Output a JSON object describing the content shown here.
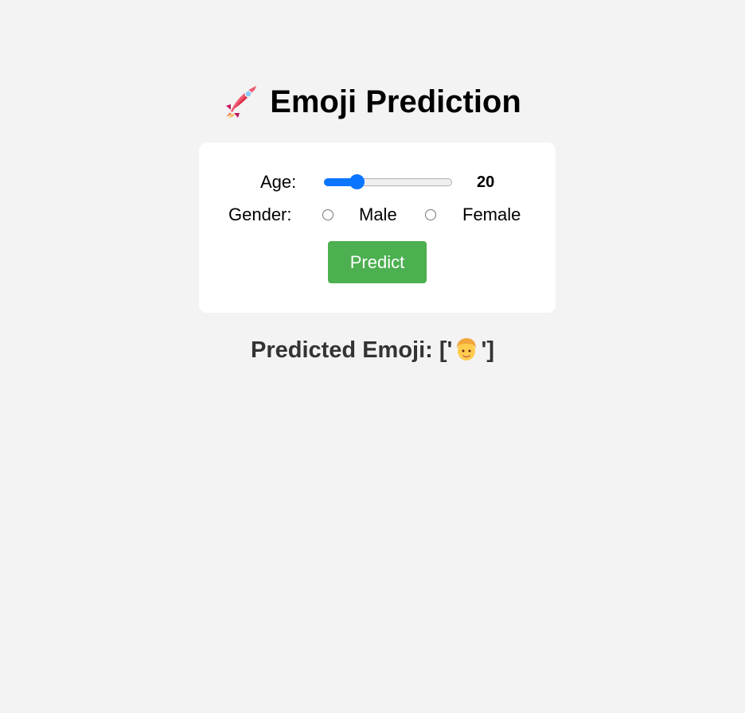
{
  "header": {
    "icon": "rocket-icon",
    "title": "Emoji Prediction"
  },
  "form": {
    "age_label": "Age:",
    "age_value": "20",
    "age_fraction": 0.23,
    "gender_label": "Gender:",
    "gender_options": [
      "Male",
      "Female"
    ],
    "predict_label": "Predict"
  },
  "result": {
    "prefix": "Predicted Emoji: ['",
    "emoji_icon": "blond-man-face-icon",
    "suffix": "']"
  },
  "colors": {
    "background": "#f3f3f3",
    "card": "#ffffff",
    "slider_accent": "#0a75ff",
    "button": "#4caf50",
    "result_text": "#333333"
  }
}
